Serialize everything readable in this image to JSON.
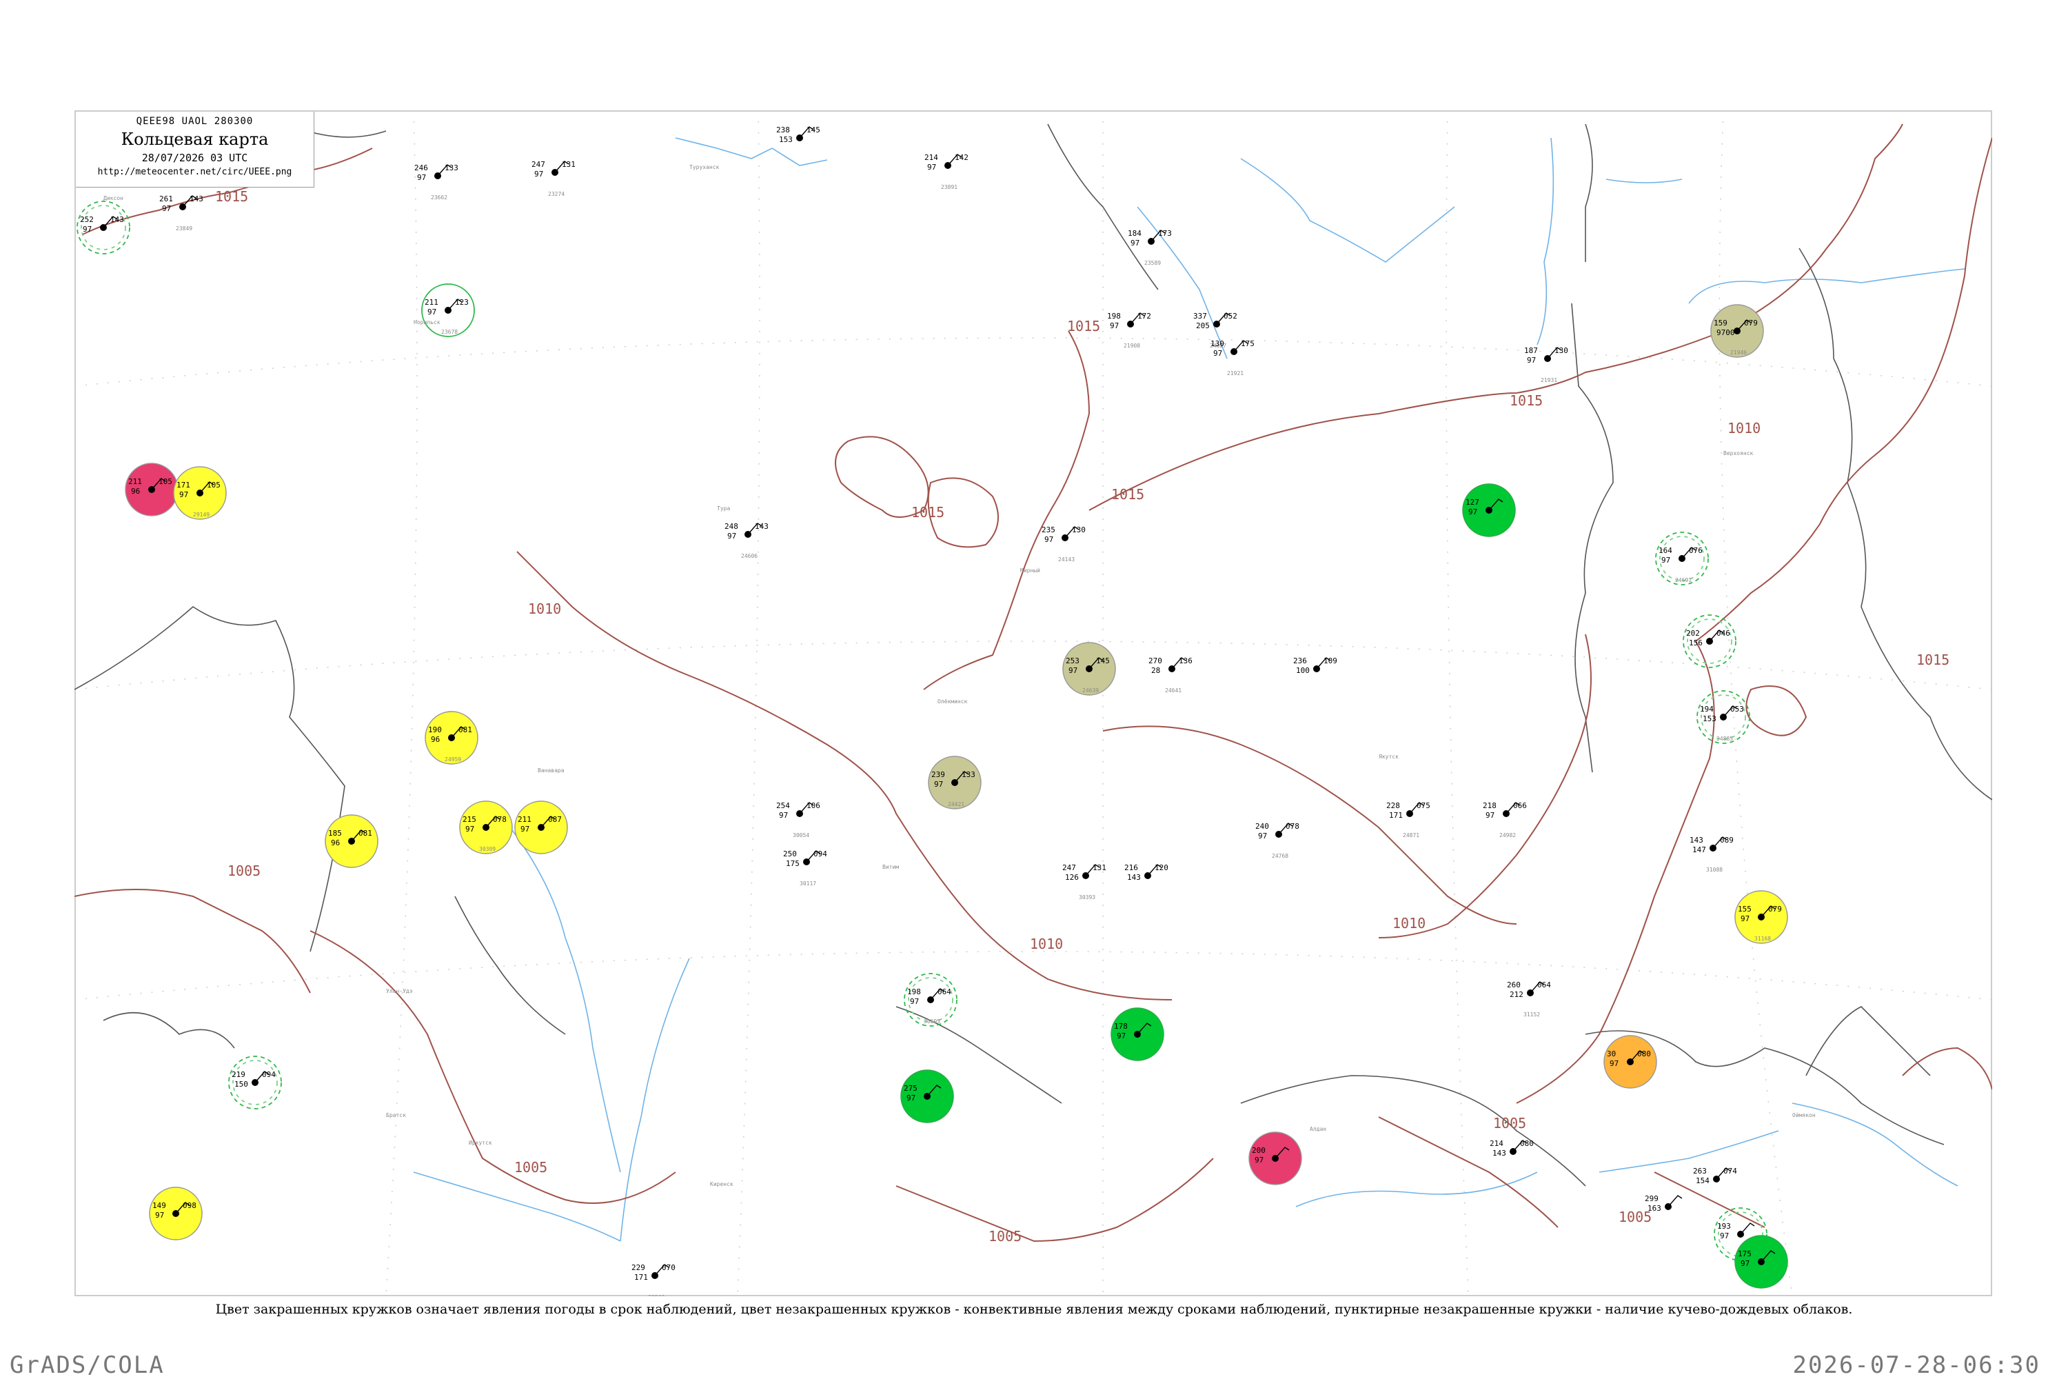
{
  "header": {
    "codes": "QEEE98  UAOL  280300",
    "title": "Кольцевая карта",
    "date": "28/07/2026 03 UTC",
    "url": "http://meteocenter.net/circ/UEEE.png"
  },
  "caption": "Цвет закрашенных кружков означает явления погоды в срок наблюдений, цвет незакрашенных кружков - конвективные явления между сроками наблюдений, пунктирные незакрашенные кружки - наличие кучево-дождевых облаков.",
  "footer": {
    "left": "GrADS/COLA",
    "right": "2026-07-28-06:30"
  },
  "colors": {
    "isobar": "#a0524a",
    "river": "#6fb3e8",
    "border": "#555555",
    "storm": "#00c832",
    "rain_shower": "#66ee88",
    "mist": "#ffff33",
    "fog_dust": "#e63c6e",
    "haze": "#c8c896",
    "smoke": "#ffb43c"
  },
  "isobars": [
    {
      "label": "1015"
    },
    {
      "label": "1015"
    },
    {
      "label": "1015"
    },
    {
      "label": "1015"
    },
    {
      "label": "1015"
    },
    {
      "label": "1010"
    },
    {
      "label": "1010"
    },
    {
      "label": "1010"
    },
    {
      "label": "1010"
    },
    {
      "label": "1005"
    },
    {
      "label": "1005"
    },
    {
      "label": "1005"
    },
    {
      "label": "1005"
    },
    {
      "label": "1005"
    },
    {
      "label": "1015"
    }
  ],
  "stations": [
    {
      "t": "252",
      "p": "143",
      "v": "97",
      "id": "",
      "style": "dashed-green"
    },
    {
      "t": "261",
      "p": "143",
      "v": "97",
      "id": "23849",
      "style": "plain"
    },
    {
      "t": "211",
      "p": "123",
      "v": "97",
      "id": "23678",
      "style": "open-green"
    },
    {
      "t": "246",
      "p": "133",
      "v": "97",
      "id": "23662",
      "style": "plain"
    },
    {
      "t": "247",
      "p": "131",
      "v": "97",
      "id": "23274",
      "style": "plain"
    },
    {
      "t": "238",
      "p": "145",
      "v": "153",
      "id": "",
      "style": "plain"
    },
    {
      "t": "214",
      "p": "142",
      "v": "97",
      "id": "23891",
      "style": "plain"
    },
    {
      "t": "184",
      "p": "173",
      "v": "97",
      "id": "23589",
      "style": "plain"
    },
    {
      "t": "198",
      "p": "172",
      "v": "97",
      "id": "21908",
      "style": "plain"
    },
    {
      "t": "337",
      "p": "052",
      "v": "205",
      "id": "24027",
      "style": "plain"
    },
    {
      "t": "130",
      "p": "175",
      "v": "97",
      "id": "21921",
      "style": "plain"
    },
    {
      "t": "159",
      "p": "079",
      "v": "9700",
      "id": "21946",
      "style": "haze"
    },
    {
      "t": "187",
      "p": "130",
      "v": "97",
      "id": "21931",
      "style": "plain"
    },
    {
      "t": "211",
      "p": "105",
      "v": "96",
      "id": "",
      "style": "fog"
    },
    {
      "t": "171",
      "p": "105",
      "v": "97",
      "id": "29149",
      "style": "mist"
    },
    {
      "t": "248",
      "p": "143",
      "v": "97",
      "id": "24606",
      "style": "plain"
    },
    {
      "t": "235",
      "p": "130",
      "v": "97",
      "id": "24143",
      "style": "plain"
    },
    {
      "t": "127",
      "p": "",
      "v": "97",
      "id": "",
      "style": "storm"
    },
    {
      "t": "164",
      "p": "076",
      "v": "97",
      "id": "24691",
      "style": "dashed-green"
    },
    {
      "t": "202",
      "p": "046",
      "v": "156",
      "id": "",
      "style": "dashed-green"
    },
    {
      "t": "194",
      "p": "053",
      "v": "153",
      "id": "24885",
      "style": "dashed-green"
    },
    {
      "t": "253",
      "p": "145",
      "v": "97",
      "id": "24639",
      "style": "haze"
    },
    {
      "t": "270",
      "p": "136",
      "v": "28",
      "id": "24641",
      "style": "plain"
    },
    {
      "t": "236",
      "p": "109",
      "v": "100",
      "id": "",
      "style": "plain"
    },
    {
      "t": "190",
      "p": "081",
      "v": "96",
      "id": "24959",
      "style": "mist"
    },
    {
      "t": "239",
      "p": "133",
      "v": "97",
      "id": "24421",
      "style": "haze"
    },
    {
      "t": "215",
      "p": "078",
      "v": "97",
      "id": "30309",
      "style": "mist"
    },
    {
      "t": "211",
      "p": "087",
      "v": "97",
      "id": "",
      "style": "mist"
    },
    {
      "t": "185",
      "p": "081",
      "v": "96",
      "id": "",
      "style": "mist"
    },
    {
      "t": "254",
      "p": "106",
      "v": "97",
      "id": "30054",
      "style": "plain"
    },
    {
      "t": "250",
      "p": "094",
      "v": "175",
      "id": "30117",
      "style": "plain"
    },
    {
      "t": "247",
      "p": "131",
      "v": "126",
      "id": "30393",
      "style": "plain"
    },
    {
      "t": "216",
      "p": "120",
      "v": "143",
      "id": "",
      "style": "plain"
    },
    {
      "t": "240",
      "p": "078",
      "v": "97",
      "id": "24768",
      "style": "plain"
    },
    {
      "t": "228",
      "p": "075",
      "v": "171",
      "id": "24871",
      "style": "plain"
    },
    {
      "t": "218",
      "p": "066",
      "v": "97",
      "id": "24982",
      "style": "plain"
    },
    {
      "t": "143",
      "p": "089",
      "v": "147",
      "id": "31088",
      "style": "plain"
    },
    {
      "t": "155",
      "p": "079",
      "v": "97",
      "id": "31168",
      "style": "mist"
    },
    {
      "t": "260",
      "p": "064",
      "v": "212",
      "id": "31152",
      "style": "plain"
    },
    {
      "t": "30",
      "p": "080",
      "v": "97",
      "id": "",
      "style": "smoke"
    },
    {
      "t": "149",
      "p": "098",
      "v": "97",
      "id": "",
      "style": "mist"
    },
    {
      "t": "219",
      "p": "094",
      "v": "150",
      "id": "",
      "style": "dashed-green"
    },
    {
      "t": "198",
      "p": "064",
      "v": "97",
      "id": "30695",
      "style": "dashed-green"
    },
    {
      "t": "178",
      "p": "",
      "v": "97",
      "id": "",
      "style": "storm"
    },
    {
      "t": "200",
      "p": "",
      "v": "97",
      "id": "",
      "style": "fog"
    },
    {
      "t": "214",
      "p": "080",
      "v": "143",
      "id": "",
      "style": "plain"
    },
    {
      "t": "299",
      "p": "",
      "v": "163",
      "id": "",
      "style": "plain"
    },
    {
      "t": "263",
      "p": "074",
      "v": "154",
      "id": "",
      "style": "plain"
    },
    {
      "t": "193",
      "p": "",
      "v": "97",
      "id": "",
      "style": "dashed-green"
    },
    {
      "t": "175",
      "p": "",
      "v": "97",
      "id": "",
      "style": "storm"
    },
    {
      "t": "229",
      "p": "070",
      "v": "171",
      "id": "30043",
      "style": "plain"
    },
    {
      "t": "275",
      "p": "",
      "v": "97",
      "id": "",
      "style": "storm"
    }
  ],
  "station_names": [
    "Диксон",
    "Хатанга",
    "Норильск",
    "Туруханск",
    "Тура",
    "Ванавара",
    "Братск",
    "Киренск",
    "Витим",
    "Олёкминск",
    "Якутск",
    "Мирный",
    "Алдан",
    "Чита",
    "Иркутск",
    "Улан-Удэ",
    "Оймякон",
    "Верхоянск"
  ]
}
